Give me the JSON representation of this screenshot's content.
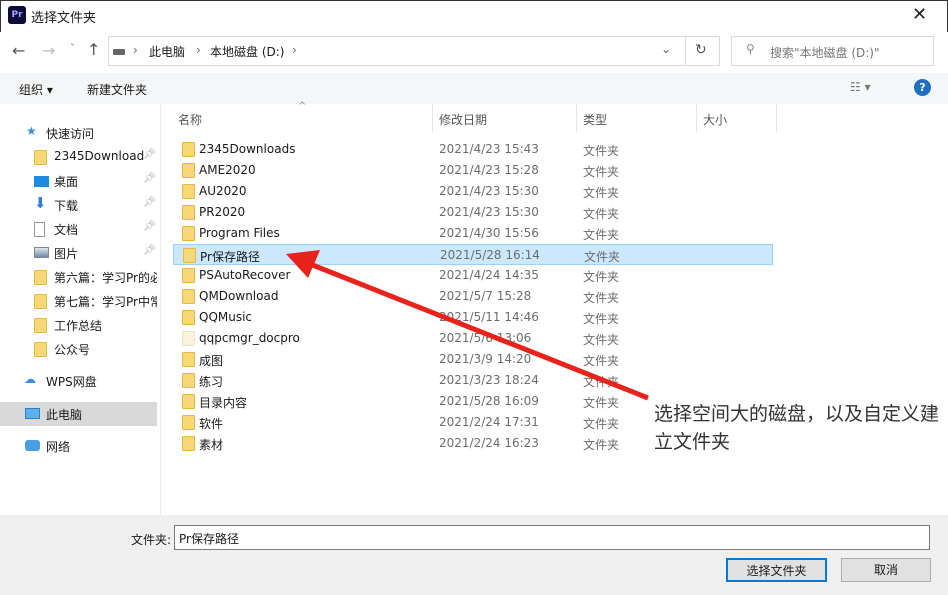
{
  "window": {
    "title": "选择文件夹",
    "app_icon": "Pr"
  },
  "address": {
    "crumbs": [
      "此电脑",
      "本地磁盘 (D:)"
    ],
    "search_placeholder": "搜索\"本地磁盘 (D:)\""
  },
  "toolbar": {
    "organize": "组织",
    "new_folder": "新建文件夹"
  },
  "sidebar": {
    "quick_access": "快速访问",
    "items": [
      {
        "label": "2345Download",
        "icon": "folder-icon",
        "pinned": true
      },
      {
        "label": "桌面",
        "icon": "desktop-icon",
        "pinned": true
      },
      {
        "label": "下载",
        "icon": "download-icon",
        "pinned": true
      },
      {
        "label": "文档",
        "icon": "document-icon",
        "pinned": true
      },
      {
        "label": "图片",
        "icon": "picture-icon",
        "pinned": true
      },
      {
        "label": "第六篇：学习Pr的必",
        "icon": "folder-icon"
      },
      {
        "label": "第七篇：学习Pr中常",
        "icon": "folder-icon"
      },
      {
        "label": "工作总结",
        "icon": "folder-icon"
      },
      {
        "label": "公众号",
        "icon": "folder-icon"
      }
    ],
    "wps": "WPS网盘",
    "this_pc": "此电脑",
    "network": "网络"
  },
  "columns": {
    "name": "名称",
    "date": "修改日期",
    "type": "类型",
    "size": "大小"
  },
  "files": [
    {
      "name": "2345Downloads",
      "date": "2021/4/23 15:43",
      "type": "文件夹"
    },
    {
      "name": "AME2020",
      "date": "2021/4/23 15:28",
      "type": "文件夹"
    },
    {
      "name": "AU2020",
      "date": "2021/4/23 15:30",
      "type": "文件夹"
    },
    {
      "name": "PR2020",
      "date": "2021/4/23 15:30",
      "type": "文件夹"
    },
    {
      "name": "Program Files",
      "date": "2021/4/30 15:56",
      "type": "文件夹"
    },
    {
      "name": "Pr保存路径",
      "date": "2021/5/28 16:14",
      "type": "文件夹",
      "selected": true
    },
    {
      "name": "PSAutoRecover",
      "date": "2021/4/24 14:35",
      "type": "文件夹"
    },
    {
      "name": "QMDownload",
      "date": "2021/5/7 15:28",
      "type": "文件夹"
    },
    {
      "name": "QQMusic",
      "date": "2021/5/11 14:46",
      "type": "文件夹"
    },
    {
      "name": "qqpcmgr_docpro",
      "date": "2021/5/6 13:06",
      "type": "文件夹"
    },
    {
      "name": "成图",
      "date": "2021/3/9 14:20",
      "type": "文件夹"
    },
    {
      "name": "练习",
      "date": "2021/3/23 18:24",
      "type": "文件夹"
    },
    {
      "name": "目录内容",
      "date": "2021/5/28 16:09",
      "type": "文件夹"
    },
    {
      "name": "软件",
      "date": "2021/2/24 17:31",
      "type": "文件夹"
    },
    {
      "name": "素材",
      "date": "2021/2/24 16:23",
      "type": "文件夹"
    }
  ],
  "footer": {
    "folder_label": "文件夹:",
    "folder_value": "Pr保存路径",
    "select": "选择文件夹",
    "cancel": "取消"
  },
  "annotation": {
    "text": "选择空间大的磁盘，以及自定义建立文件夹",
    "arrow_color": "#e8231c"
  }
}
